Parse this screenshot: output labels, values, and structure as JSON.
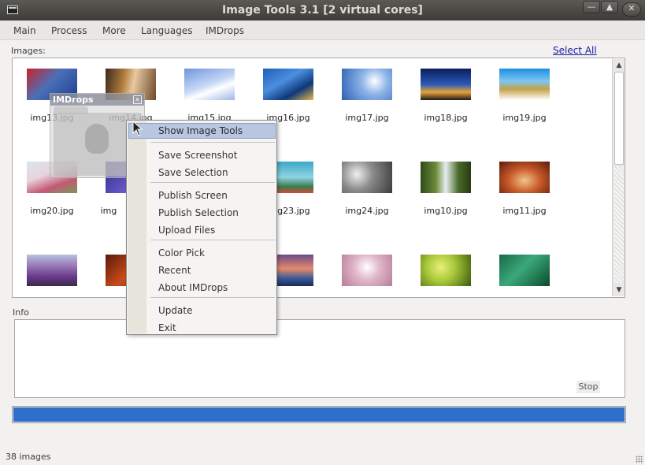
{
  "window": {
    "title": "Image Tools 3.1 [2 virtual cores]"
  },
  "menubar": {
    "items": [
      "Main",
      "Process",
      "More",
      "Languages",
      "IMDrops"
    ]
  },
  "gallery": {
    "label": "Images:",
    "select_all": "Select All",
    "rows": [
      [
        "img13.jpg",
        "img14.jpg",
        "img15.jpg",
        "img16.jpg",
        "img17.jpg",
        "img18.jpg",
        "img19.jpg"
      ],
      [
        "img20.jpg",
        "img",
        "",
        "img23.jpg",
        "img24.jpg",
        "img10.jpg",
        "img11.jpg"
      ]
    ]
  },
  "floating_window": {
    "title": "IMDrops"
  },
  "context_menu": {
    "items": [
      "Show Image Tools",
      "Save Screenshot",
      "Save Selection",
      "Publish Screen",
      "Publish Selection",
      "Upload Files",
      "Color Pick",
      "Recent",
      "About IMDrops",
      "Update",
      "Exit"
    ]
  },
  "info": {
    "label": "Info",
    "stop_label": "Stop"
  },
  "progress": {
    "value": 1.0,
    "color": "#2e6fcc"
  },
  "status": {
    "text": "38 images"
  }
}
